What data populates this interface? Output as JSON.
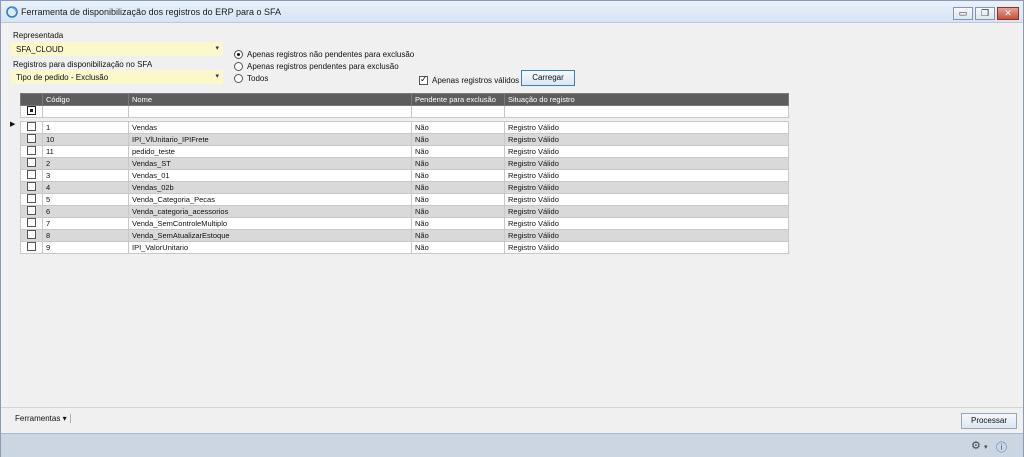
{
  "window": {
    "title": "Ferramenta de disponibilização dos registros do ERP para o SFA",
    "icon": "app-icon",
    "controls": {
      "minimize": "▭",
      "restore": "❐",
      "close": "✕"
    }
  },
  "form": {
    "representada_label": "Representada",
    "representada_value": "SFA_CLOUD",
    "registros_label": "Registros para disponibilização no SFA",
    "registros_value": "Tipo de pedido - Exclusão",
    "combo_arrow": "▾",
    "radios": [
      {
        "label": "Apenas registros não pendentes para exclusão",
        "selected": true
      },
      {
        "label": "Apenas registros pendentes para exclusão",
        "selected": false
      },
      {
        "label": "Todos",
        "selected": false
      }
    ],
    "validos_label": "Apenas registros válidos",
    "validos_checked": true,
    "carregar_label": "Carregar"
  },
  "grid": {
    "columns": [
      "",
      "Código",
      "Nome",
      "Pendente para exclusão",
      "Situação do registro"
    ],
    "current_row_marker": "▶",
    "rows": [
      {
        "codigo": "1",
        "nome": "Vendas",
        "pendente": "Não",
        "situacao": "Registro Válido"
      },
      {
        "codigo": "10",
        "nome": "IPI_VlUnitario_IPIFrete",
        "pendente": "Não",
        "situacao": "Registro Válido"
      },
      {
        "codigo": "11",
        "nome": "pedido_teste",
        "pendente": "Não",
        "situacao": "Registro Válido"
      },
      {
        "codigo": "2",
        "nome": "Vendas_ST",
        "pendente": "Não",
        "situacao": "Registro Válido"
      },
      {
        "codigo": "3",
        "nome": "Vendas_01",
        "pendente": "Não",
        "situacao": "Registro Válido"
      },
      {
        "codigo": "4",
        "nome": "Vendas_02b",
        "pendente": "Não",
        "situacao": "Registro Válido"
      },
      {
        "codigo": "5",
        "nome": "Venda_Categoria_Pecas",
        "pendente": "Não",
        "situacao": "Registro Válido"
      },
      {
        "codigo": "6",
        "nome": "Venda_categoria_acessorios",
        "pendente": "Não",
        "situacao": "Registro Válido"
      },
      {
        "codigo": "7",
        "nome": "Venda_SemControleMultiplo",
        "pendente": "Não",
        "situacao": "Registro Válido"
      },
      {
        "codigo": "8",
        "nome": "Venda_SemAtualizarEstoque",
        "pendente": "Não",
        "situacao": "Registro Válido"
      },
      {
        "codigo": "9",
        "nome": "IPI_ValorUnitario",
        "pendente": "Não",
        "situacao": "Registro Válido"
      }
    ]
  },
  "bottom": {
    "ferramentas_label": "Ferramentas",
    "ferramentas_arrow": "▾",
    "processar_label": "Processar"
  },
  "status": {
    "settings_glyph": "⚙",
    "settings_arrow": "▾",
    "info_glyph": "ⓘ"
  }
}
